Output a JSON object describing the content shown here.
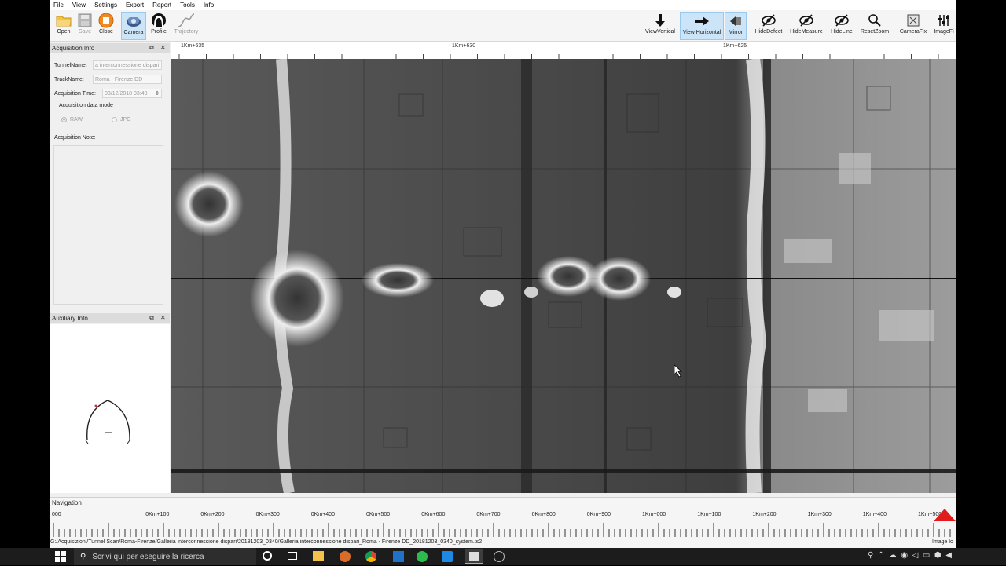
{
  "menu": [
    "File",
    "View",
    "Settings",
    "Export",
    "Report",
    "Tools",
    "Info"
  ],
  "toolbar_left": [
    {
      "label": "Open",
      "icon": "folder-icon",
      "state": "normal"
    },
    {
      "label": "Save",
      "icon": "save-icon",
      "state": "disabled"
    },
    {
      "label": "Close",
      "icon": "close-icon",
      "state": "normal"
    },
    {
      "label": "Camera",
      "icon": "camera-icon",
      "state": "active"
    },
    {
      "label": "Profile",
      "icon": "profile-icon",
      "state": "normal"
    },
    {
      "label": "Trajectory",
      "icon": "trajectory-icon",
      "state": "disabled"
    }
  ],
  "toolbar_right": [
    {
      "label": "ViewVertical",
      "icon": "arrow-down-icon",
      "state": "normal"
    },
    {
      "label": "View Horizontal",
      "icon": "arrow-right-icon",
      "state": "active"
    },
    {
      "label": "Mirror",
      "icon": "mirror-icon",
      "state": "active"
    },
    {
      "label": "HideDefect",
      "icon": "eye-slash-icon",
      "state": "normal"
    },
    {
      "label": "HideMeasure",
      "icon": "eye-slash-icon",
      "state": "normal"
    },
    {
      "label": "HideLine",
      "icon": "eye-slash-icon",
      "state": "normal"
    },
    {
      "label": "ResetZoom",
      "icon": "magnifier-icon",
      "state": "normal"
    },
    {
      "label": "CameraFix",
      "icon": "camera-fix-icon",
      "state": "normal"
    },
    {
      "label": "ImageFi",
      "icon": "image-filter-icon",
      "state": "normal"
    }
  ],
  "ruler_top": {
    "labels": [
      "1Km+635",
      "1Km+630",
      "1Km+625"
    ]
  },
  "acquisition_panel": {
    "title": "Acquisition Info",
    "tunnel_label": "TunnelName:",
    "tunnel_value": "a interconnessione dispari",
    "track_label": "TrackName:",
    "track_value": "Roma - Firenze DD",
    "time_label": "Acquisition Time:",
    "time_value": "03/12/2018 03:40",
    "mode_label": "Acquisition data mode",
    "mode_raw": "RAW",
    "mode_jpg": "JPG",
    "note_label": "Acquisition Note:"
  },
  "auxiliary_panel": {
    "title": "Auxiliary Info"
  },
  "navigation": {
    "title": "Navigation",
    "labels": [
      "000",
      "0Km+100",
      "0Km+200",
      "0Km+300",
      "0Km+400",
      "0Km+500",
      "0Km+600",
      "0Km+700",
      "0Km+800",
      "0Km+900",
      "1Km+000",
      "1Km+100",
      "1Km+200",
      "1Km+300",
      "1Km+400",
      "1Km+500",
      "1Km+60"
    ]
  },
  "status_path": "G:/Acquisizioni/Tunnel Scan/Roma-Firenze/Galleria interconnessione dispari/20181203_0340/Galleria interconnessione dispari_Roma - Firenze DD_20181203_0340_system.ts2",
  "status_right": "Image lo",
  "taskbar": {
    "search_placeholder": "Scrivi qui per eseguire la ricerca"
  }
}
